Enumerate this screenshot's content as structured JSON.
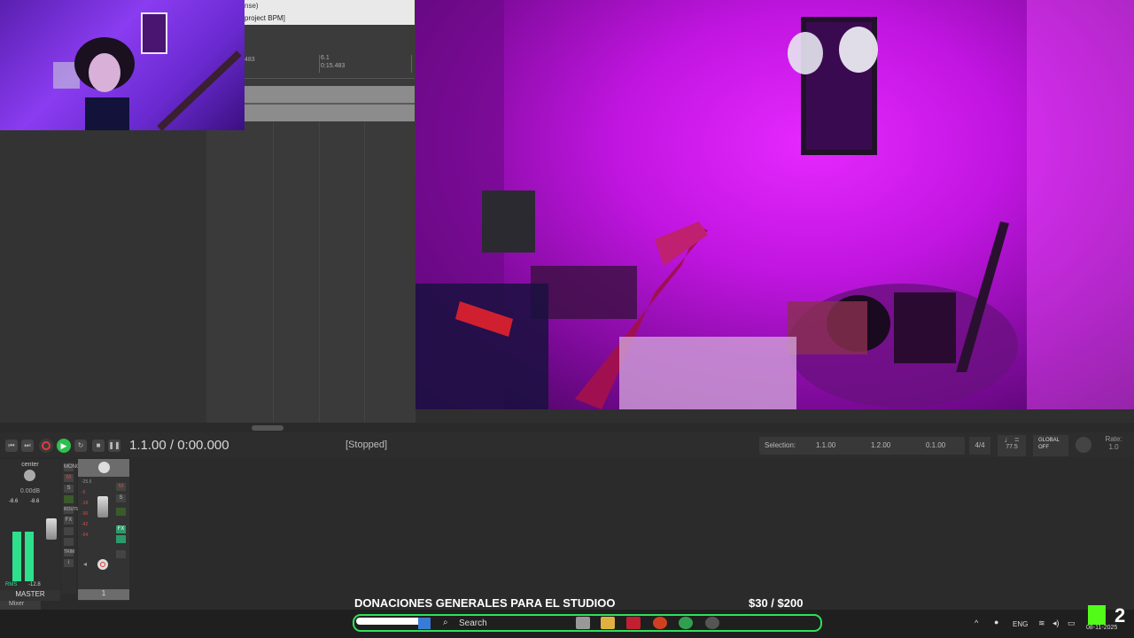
{
  "arrange": {
    "header_line1": "nse)",
    "header_line2": "project BPM]",
    "ruler_labels": [
      {
        "top": "6.1",
        "bottom": "0:15.483"
      }
    ],
    "ruler_left_label": "483"
  },
  "transport": {
    "time_position": "1.1.00 / 0:00.000",
    "status": "[Stopped]",
    "selection_label": "Selection:",
    "selection_start": "1.1.00",
    "selection_end": "1.2.00",
    "selection_length": "0.1.00",
    "time_signature": "4/4",
    "bpm": "77.5",
    "global_label": "GLOBAL",
    "global_state": "OFF",
    "rate_label": "Rate:",
    "rate_value": "1.0"
  },
  "mixer": {
    "tab_label": "Mixer",
    "master": {
      "pan_label": "center",
      "volume_db": "0.00dB",
      "peak_left": "-8.6",
      "peak_right": "-8.6",
      "label": "MASTER",
      "rms_label": "RMS",
      "rms_value": "-12.8"
    },
    "route_buttons": [
      "MONO",
      "M",
      "S",
      "ROUTE",
      "FX",
      "TRIM"
    ],
    "track": {
      "number": "1",
      "scale": [
        "-25.6",
        "-6",
        "-18",
        "-30",
        "-42",
        "-54"
      ]
    }
  },
  "overlay": {
    "donation_title": "DONACIONES GENERALES PARA EL STUDIOO",
    "donation_amount": "$30   / $200",
    "progress_fraction": 0.15
  },
  "taskbar": {
    "search_placeholder": "Search",
    "language": "ENG",
    "date": "08-11-2025"
  },
  "colors": {
    "accent_green": "#2fe05a",
    "meter_green": "#2ee08c",
    "record_red": "#e23b3b",
    "cam_magenta": "#e628ff"
  }
}
